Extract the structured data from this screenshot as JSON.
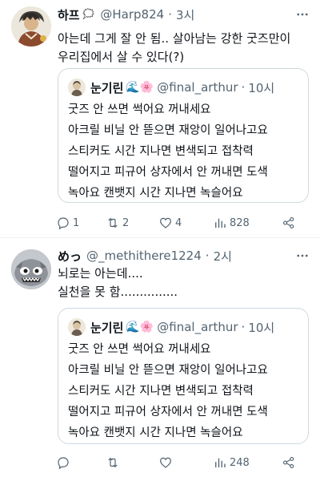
{
  "tweets": [
    {
      "name": "하프",
      "name_emoji": "🗯",
      "handle": "@Harp824",
      "dot": "·",
      "time": "3시",
      "body_lines": [
        "아는데 그게 잘 안 됨.. 살아남는 강한 굿즈만이",
        "우리집에서 살 수 있다(?)"
      ],
      "quote": {
        "name": "눈기린",
        "emojis": "🌊🌸",
        "handle": "@final_arthur",
        "dot": "·",
        "time": "10시",
        "lines": [
          "굿즈 안 쓰면 썩어요 꺼내세요",
          "아크릴 비닐 안 뜯으면 재앙이 일어나고요",
          "스티커도 시간 지나면 변색되고 접착력",
          "떨어지고 피규어 상자에서 안 꺼내면 도색",
          "녹아요 캔뱃지 시간 지나면 녹슬어요"
        ]
      },
      "actions": {
        "replies": "1",
        "retweets": "2",
        "likes": "4",
        "views": "828"
      }
    },
    {
      "name": "めっ",
      "handle": "@_methithere1224",
      "dot": "·",
      "time": "2시",
      "body_lines": [
        "뇌로는 아는데....",
        "실천을 못 함..............."
      ],
      "quote": {
        "name": "눈기린",
        "emojis": "🌊🌸",
        "handle": "@final_arthur",
        "dot": "·",
        "time": "10시",
        "lines": [
          "굿즈 안 쓰면 썩어요 꺼내세요",
          "아크릴 비닐 안 뜯으면 재앙이 일어나고요",
          "스티커도 시간 지나면 변색되고 접착력",
          "떨어지고 피규어 상자에서 안 꺼내면 도색",
          "녹아요 캔뱃지 시간 지나면 녹슬어요"
        ]
      },
      "actions": {
        "replies": "",
        "retweets": "",
        "likes": "",
        "views": "248"
      }
    }
  ],
  "colors": {
    "text": "#0f1419",
    "secondary": "#536471",
    "border": "#cfd9de",
    "divider": "#eff3f4"
  },
  "icons": [
    "more-icon",
    "reply-icon",
    "retweet-icon",
    "like-icon",
    "views-icon",
    "share-icon"
  ]
}
